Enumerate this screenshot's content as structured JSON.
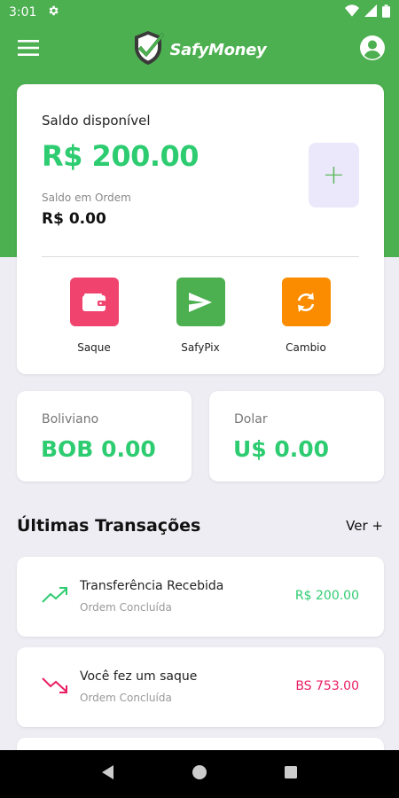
{
  "status_bar": {
    "time": "3:01"
  },
  "app": {
    "name": "SafyMoney"
  },
  "balance": {
    "available_label": "Saldo disponível",
    "available_amount": "R$ 200.00",
    "order_label": "Saldo em Ordem",
    "order_amount": "R$ 0.00",
    "add_label": "+"
  },
  "actions": [
    {
      "label": "Saque",
      "color": "#f0436e",
      "icon": "wallet-icon"
    },
    {
      "label": "SafyPix",
      "color": "#4caf50",
      "icon": "send-icon"
    },
    {
      "label": "Cambio",
      "color": "#fb8c00",
      "icon": "exchange-icon"
    }
  ],
  "currencies": [
    {
      "label": "Boliviano",
      "amount": "BOB 0.00"
    },
    {
      "label": "Dolar",
      "amount": "U$ 0.00"
    }
  ],
  "transactions_section": {
    "title": "Últimas Transações",
    "see_more": "Ver +"
  },
  "transactions": [
    {
      "title": "Transferência Recebida",
      "status": "Ordem Concluída",
      "amount": "R$ 200.00",
      "direction": "in",
      "color": "#2ecc71"
    },
    {
      "title": "Você fez um saque",
      "status": "Ordem Concluída",
      "amount": "BS 753.00",
      "direction": "out",
      "color": "#e91e63"
    }
  ],
  "colors": {
    "primary_green": "#4caf50",
    "amount_green": "#2ecc71",
    "add_bg": "#ebe8fb"
  }
}
